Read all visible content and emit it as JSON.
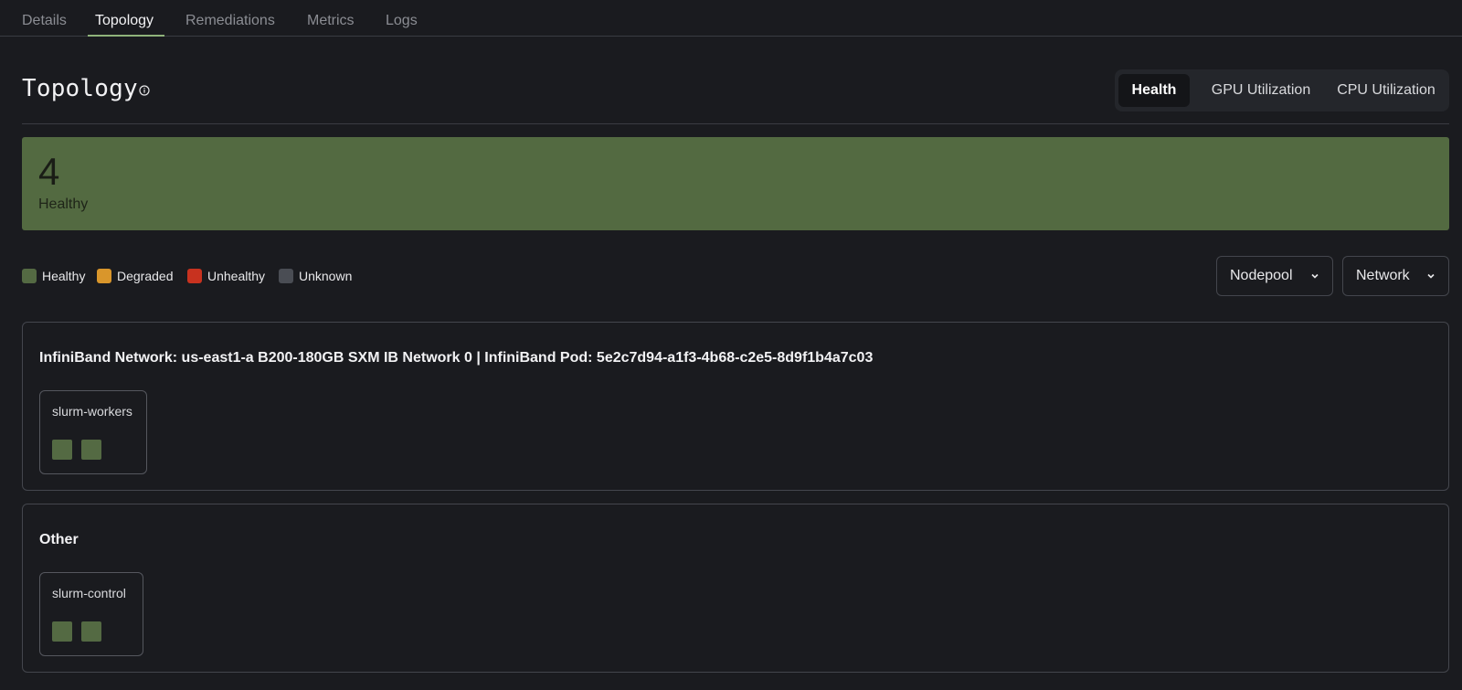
{
  "tabs": [
    {
      "label": "Details"
    },
    {
      "label": "Topology"
    },
    {
      "label": "Remediations"
    },
    {
      "label": "Metrics"
    },
    {
      "label": "Logs"
    }
  ],
  "active_tab": "Topology",
  "header": {
    "title": "Topology",
    "info_icon": "info-circle-icon",
    "view_modes": [
      "Health",
      "GPU Utilization",
      "CPU Utilization"
    ],
    "active_view": "Health"
  },
  "summary": {
    "count": "4",
    "label": "Healthy",
    "color": "#536a41"
  },
  "legend": [
    {
      "label": "Healthy",
      "color": "#546a43"
    },
    {
      "label": "Degraded",
      "color": "#d9962b"
    },
    {
      "label": "Unhealthy",
      "color": "#c8321f"
    },
    {
      "label": "Unknown",
      "color": "#4a4d54"
    }
  ],
  "filters": {
    "nodepool": "Nodepool",
    "network": "Network",
    "chevron_icon": "chevron-down-icon"
  },
  "groups": [
    {
      "title": "InfiniBand Network: us-east1-a B200-180GB SXM IB Network 0 | InfiniBand Pod: 5e2c7d94-a1f3-4b68-c2e5-8d9f1b4a7c03",
      "pools": [
        {
          "name": "slurm-workers",
          "nodes": [
            "Healthy",
            "Healthy"
          ]
        }
      ]
    },
    {
      "title": "Other",
      "pools": [
        {
          "name": "slurm-control",
          "nodes": [
            "Healthy",
            "Healthy"
          ]
        }
      ]
    }
  ]
}
